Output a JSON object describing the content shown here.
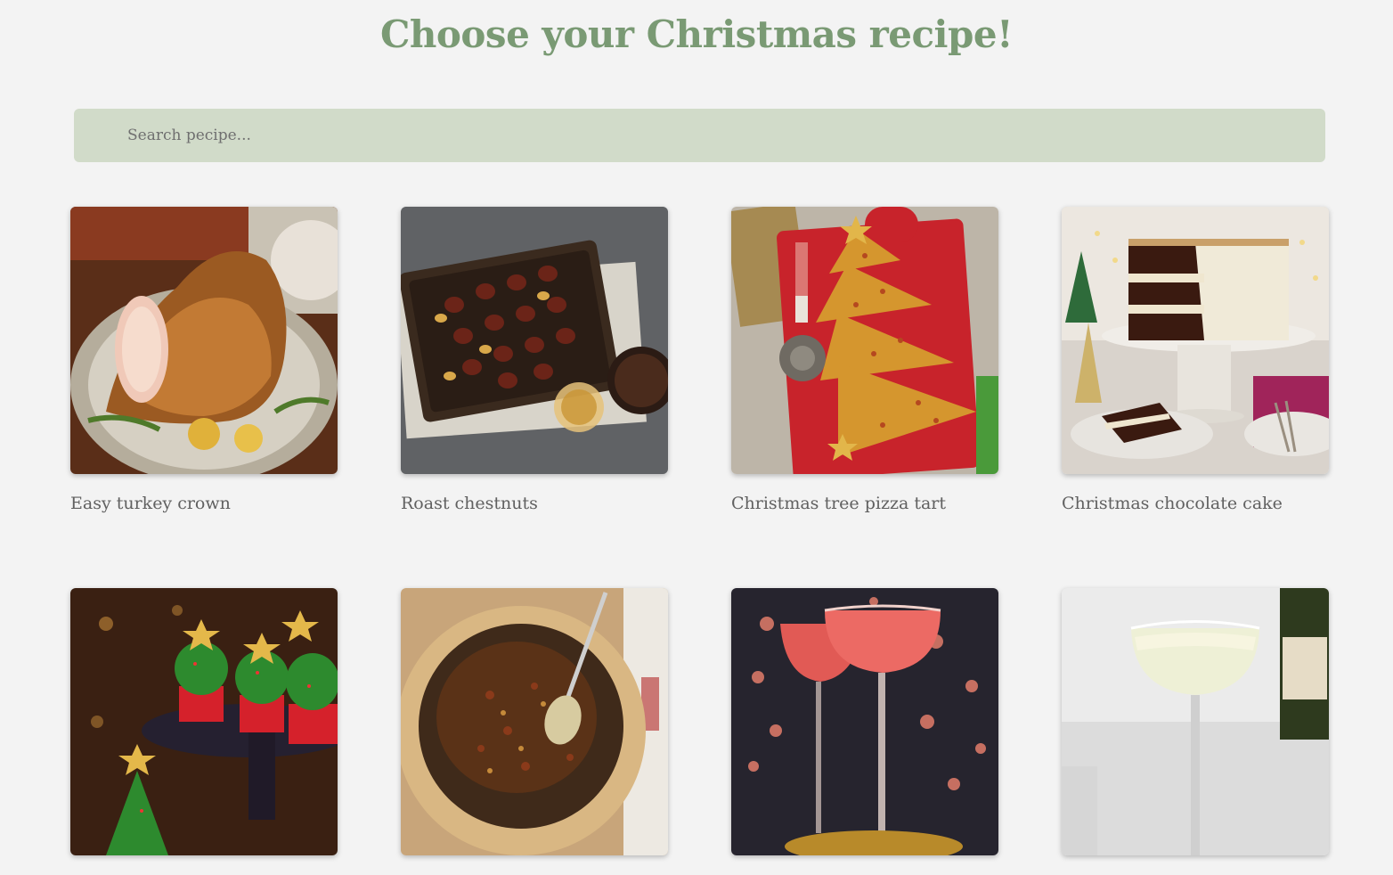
{
  "page": {
    "title": "Choose your Christmas recipe!"
  },
  "search": {
    "placeholder": "Search pecipe..."
  },
  "recipes": [
    {
      "name": "Easy turkey crown",
      "image": "turkey-crown"
    },
    {
      "name": "Roast chestnuts",
      "image": "roast-chestnuts"
    },
    {
      "name": "Christmas tree pizza tart",
      "image": "pizza-tart"
    },
    {
      "name": "Christmas chocolate cake",
      "image": "chocolate-cake"
    },
    {
      "name": "",
      "image": "christmas-cupcakes"
    },
    {
      "name": "",
      "image": "christmas-pudding"
    },
    {
      "name": "",
      "image": "pink-cocktails"
    },
    {
      "name": "",
      "image": "champagne-glass"
    }
  ],
  "colors": {
    "title": "#7a9a74",
    "search_bg": "#d1dbc9",
    "page_bg": "#f3f3f3"
  }
}
